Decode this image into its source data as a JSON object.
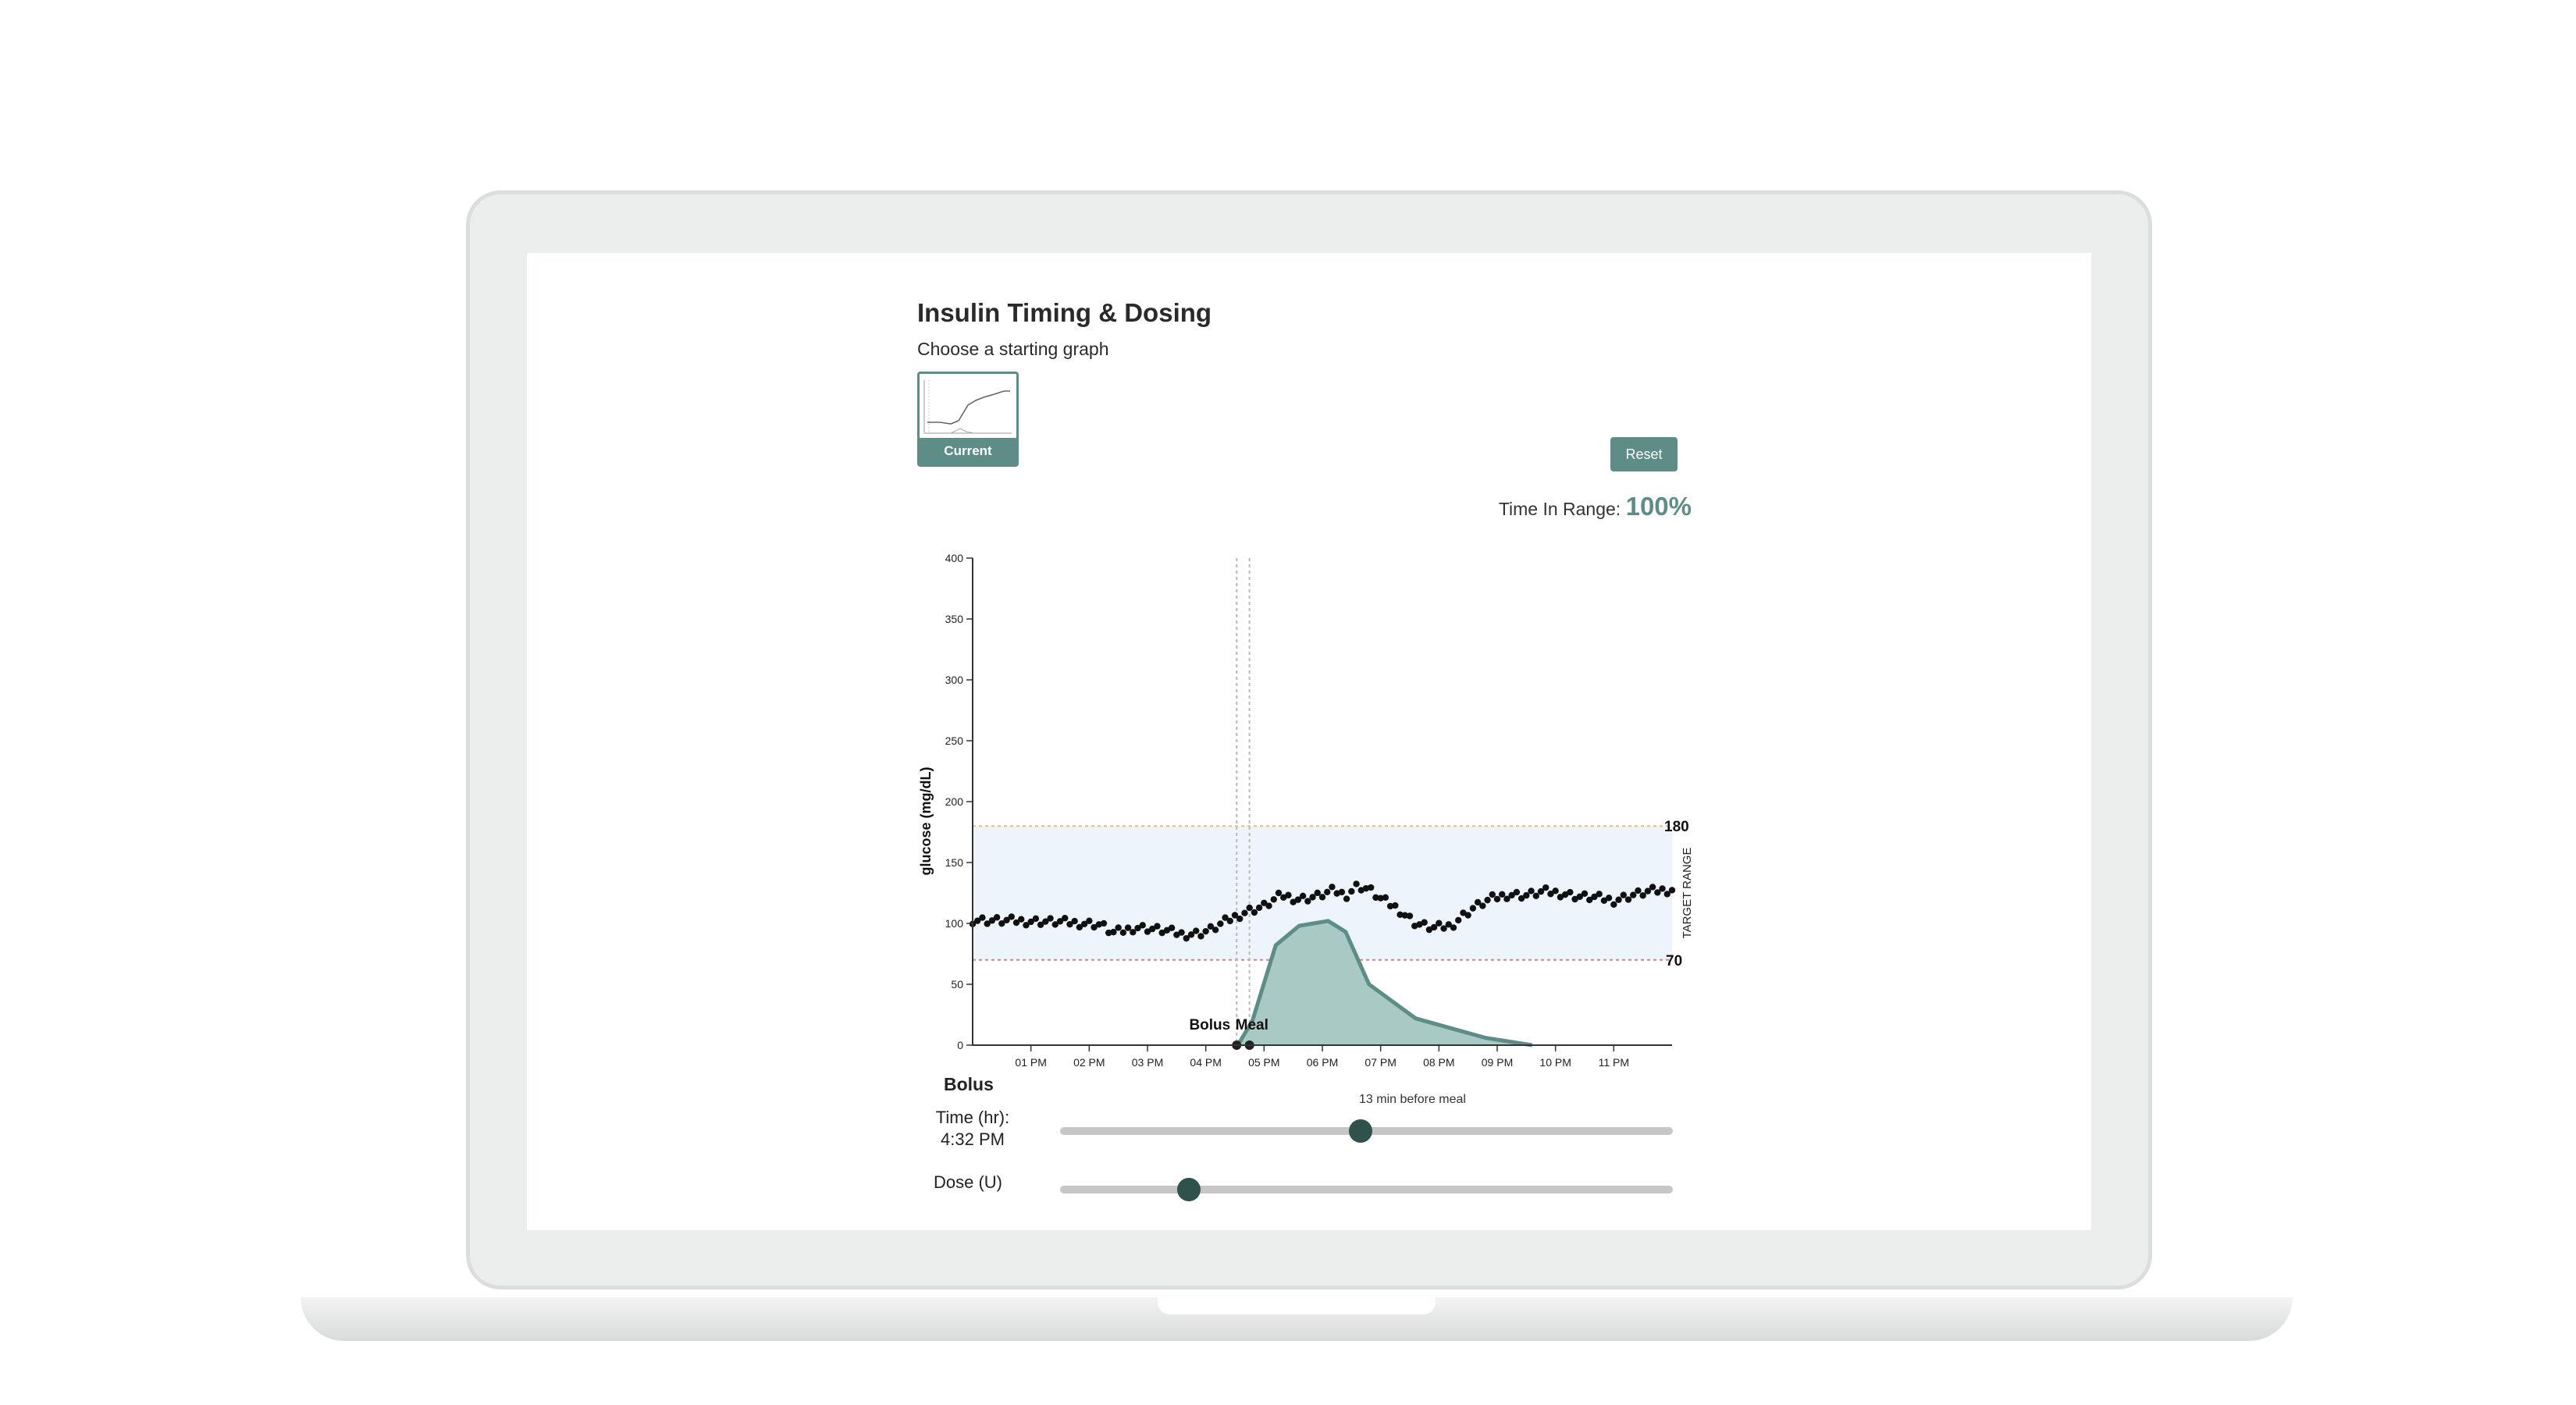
{
  "page": {
    "title": "Insulin Timing & Dosing",
    "subtitle": "Choose a starting graph"
  },
  "thumbnail": {
    "label": "Current"
  },
  "reset_label": "Reset",
  "time_in_range": {
    "label": "Time In Range: ",
    "value": "100%"
  },
  "bolus": {
    "section_label": "Bolus",
    "time_label": "Time (hr):",
    "time_value": "4:32 PM",
    "timing_note": "13 min before meal",
    "time_slider_fraction": 0.49,
    "dose_label": "Dose (U)",
    "dose_slider_fraction": 0.21
  },
  "colors": {
    "accent": "#5e8c86",
    "slider_thumb": "#2f524c",
    "target_band": "#eef4fb",
    "upper_limit_line": "#e8c07a",
    "lower_limit_line": "#d9808e",
    "insulin_fill": "#a9c9c4",
    "insulin_stroke": "#5e8c86"
  },
  "chart_data": {
    "type": "scatter",
    "ylabel": "glucose (mg/dL)",
    "ylim": [
      0,
      400
    ],
    "yticks": [
      0,
      50,
      100,
      150,
      200,
      250,
      300,
      350,
      400
    ],
    "xlim": [
      12.0,
      24.0
    ],
    "xticks": [
      {
        "t": 13,
        "label": "01 PM"
      },
      {
        "t": 14,
        "label": "02 PM"
      },
      {
        "t": 15,
        "label": "03 PM"
      },
      {
        "t": 16,
        "label": "04 PM"
      },
      {
        "t": 17,
        "label": "05 PM"
      },
      {
        "t": 18,
        "label": "06 PM"
      },
      {
        "t": 19,
        "label": "07 PM"
      },
      {
        "t": 20,
        "label": "08 PM"
      },
      {
        "t": 21,
        "label": "09 PM"
      },
      {
        "t": 22,
        "label": "10 PM"
      },
      {
        "t": 23,
        "label": "11 PM"
      }
    ],
    "target_range": {
      "low": 70,
      "high": 180,
      "label": "TARGET RANGE",
      "low_label": "70",
      "high_label": "180"
    },
    "markers": [
      {
        "label": "Bolus",
        "t": 16.53
      },
      {
        "label": "Meal",
        "t": 16.75
      }
    ],
    "glucose_keypoints": [
      [
        12.0,
        103
      ],
      [
        12.5,
        102
      ],
      [
        13.0,
        102
      ],
      [
        13.5,
        101
      ],
      [
        14.0,
        100
      ],
      [
        14.2,
        99
      ],
      [
        14.4,
        92
      ],
      [
        14.6,
        94
      ],
      [
        14.8,
        97
      ],
      [
        15.0,
        96
      ],
      [
        15.3,
        94
      ],
      [
        15.6,
        91
      ],
      [
        15.9,
        92
      ],
      [
        16.1,
        95
      ],
      [
        16.4,
        103
      ],
      [
        16.7,
        110
      ],
      [
        17.0,
        114
      ],
      [
        17.3,
        123
      ],
      [
        17.6,
        120
      ],
      [
        17.9,
        122
      ],
      [
        18.2,
        127
      ],
      [
        18.4,
        123
      ],
      [
        18.6,
        131
      ],
      [
        18.8,
        128
      ],
      [
        19.0,
        120
      ],
      [
        19.3,
        112
      ],
      [
        19.6,
        100
      ],
      [
        19.9,
        96
      ],
      [
        20.2,
        98
      ],
      [
        20.4,
        106
      ],
      [
        20.6,
        113
      ],
      [
        20.9,
        120
      ],
      [
        21.2,
        124
      ],
      [
        21.5,
        123
      ],
      [
        21.8,
        126
      ],
      [
        22.1,
        125
      ],
      [
        22.4,
        122
      ],
      [
        22.7,
        121
      ],
      [
        23.0,
        119
      ],
      [
        23.3,
        123
      ],
      [
        23.6,
        126
      ],
      [
        24.0,
        128
      ]
    ],
    "insulin_curve": [
      [
        16.55,
        0
      ],
      [
        16.8,
        20
      ],
      [
        17.2,
        82
      ],
      [
        17.6,
        98
      ],
      [
        18.1,
        102
      ],
      [
        18.4,
        93
      ],
      [
        18.8,
        50
      ],
      [
        19.6,
        22
      ],
      [
        20.2,
        14
      ],
      [
        20.8,
        6
      ],
      [
        21.6,
        0
      ]
    ]
  }
}
